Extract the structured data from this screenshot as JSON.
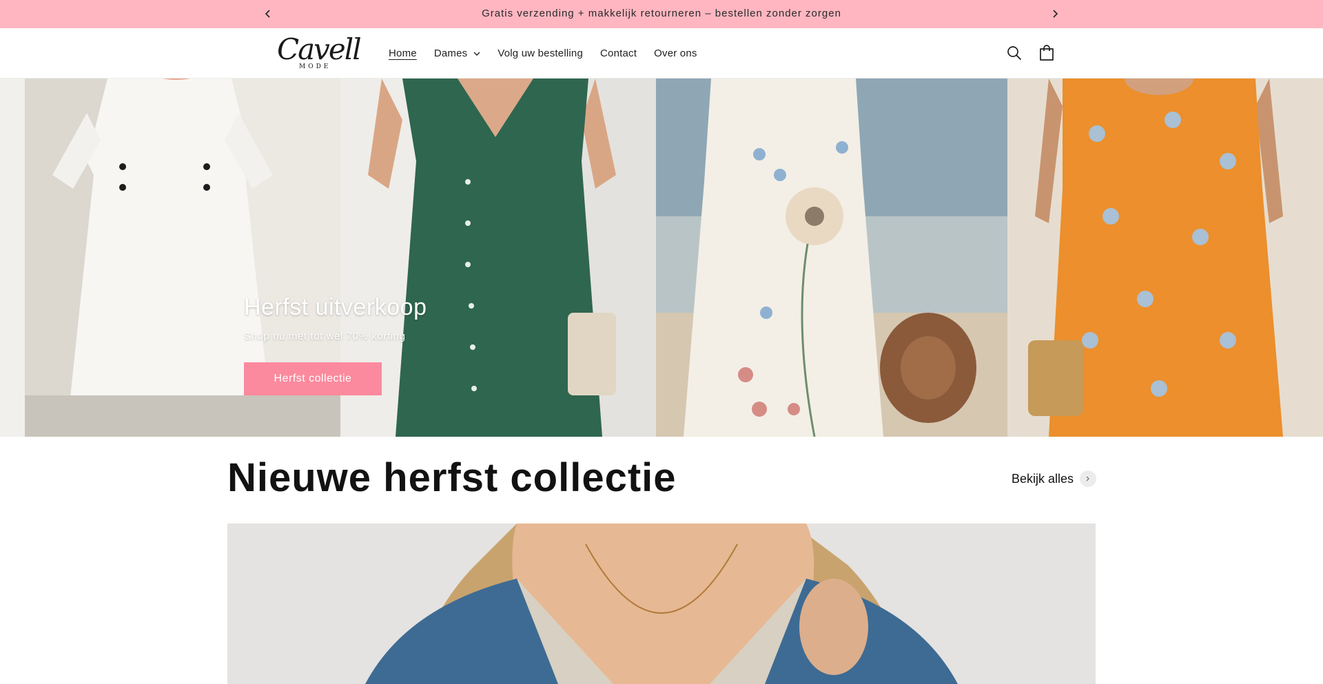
{
  "announcement": {
    "text": "Gratis verzending + makkelijk retourneren – bestellen zonder zorgen",
    "prev_icon": "chevron-left-icon",
    "next_icon": "chevron-right-icon"
  },
  "header": {
    "logo_script": "Cavell",
    "logo_sub": "MODE",
    "nav": [
      {
        "label": "Home",
        "active": true
      },
      {
        "label": "Dames",
        "has_dropdown": true
      },
      {
        "label": "Volg uw bestelling"
      },
      {
        "label": "Contact"
      },
      {
        "label": "Over ons"
      }
    ],
    "icons": [
      "search-icon",
      "cart-icon"
    ]
  },
  "hero": {
    "title": "Herfst uitverkoop",
    "subtitle": "Shop nu met tot wel 70% korting",
    "button_label": "Herfst collectie"
  },
  "collection": {
    "title": "Nieuwe herfst collectie",
    "view_all_label": "Bekijk alles"
  },
  "colors": {
    "announcement_bg": "#ffb6c1",
    "button_bg": "#fb8a9e",
    "text": "#121212"
  }
}
